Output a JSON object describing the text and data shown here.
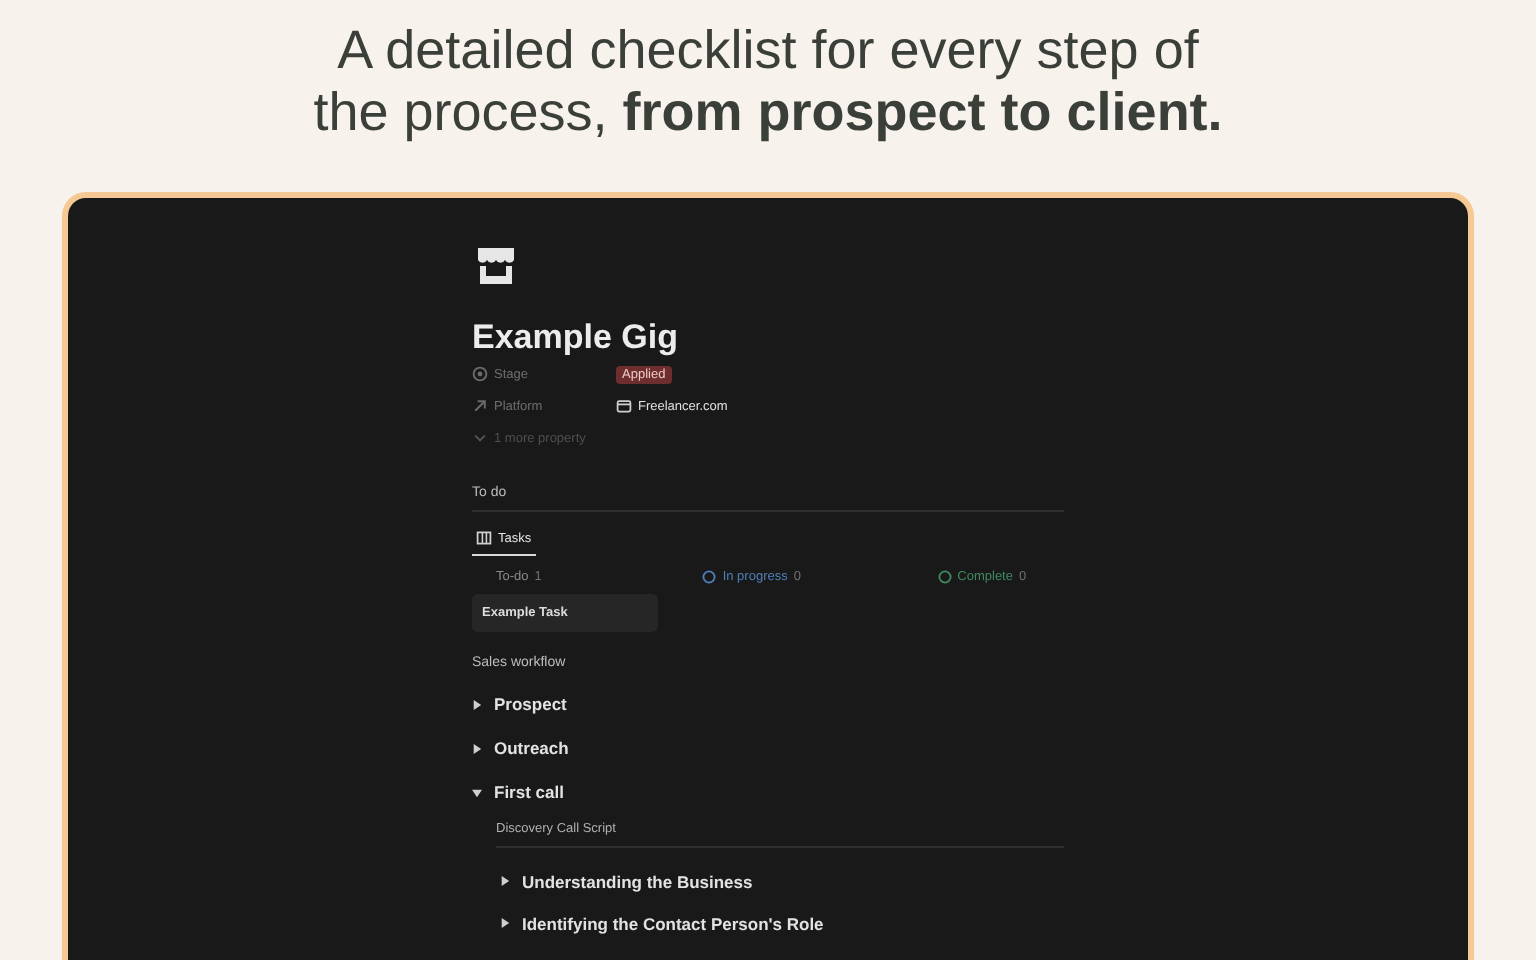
{
  "headline": "A detailed checklist for every step of the process, **from prospect to client.**",
  "page": {
    "title": "Example Gig",
    "properties": [
      {
        "kind": "select",
        "label": "Stage",
        "value": "Applied",
        "color": "#6e2e2e"
      },
      {
        "kind": "link",
        "label": "Platform",
        "value": "Freelancer.com"
      }
    ],
    "more_properties": "1 more property",
    "todo": {
      "heading": "To do",
      "tabs": [
        {
          "label": "Tasks",
          "selected": true
        }
      ],
      "columns": [
        {
          "name": "To-do",
          "count": "1",
          "color": "#8a8a8a",
          "cards": [
            "Example Task"
          ]
        },
        {
          "name": "In progress",
          "count": "0",
          "color": "#4f7fb8"
        },
        {
          "name": "Complete",
          "count": "0",
          "color": "#3f8a5e"
        }
      ]
    },
    "workflow": {
      "heading": "Sales workflow",
      "items": [
        {
          "label": "Prospect",
          "expanded": false
        },
        {
          "label": "Outreach",
          "expanded": false
        },
        {
          "label": "First call",
          "expanded": true,
          "children": [
            {
              "kind": "subheading",
              "label": "Discovery Call Script"
            },
            {
              "kind": "toggle",
              "label": "Understanding the Business",
              "expanded": false
            },
            {
              "kind": "toggle",
              "label": "Identifying the Contact Person's Role",
              "expanded": false
            }
          ]
        }
      ]
    }
  }
}
